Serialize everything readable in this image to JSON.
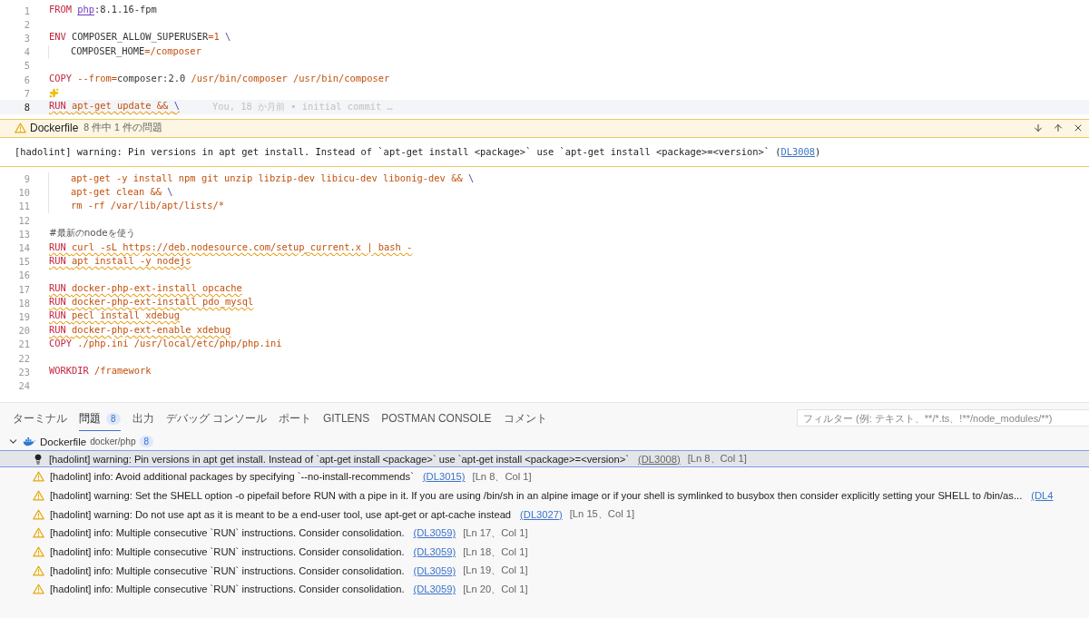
{
  "editor": {
    "lines_before": [
      {
        "number": "1",
        "segments": [
          {
            "text": "FROM ",
            "kind": "keyword"
          },
          {
            "text": "php",
            "kind": "link"
          },
          {
            "text": ":8.1.16-fpm",
            "kind": "plain"
          }
        ]
      },
      {
        "number": "2"
      },
      {
        "number": "3",
        "segments": [
          {
            "text": "ENV ",
            "kind": "keyword"
          },
          {
            "text": "COMPOSER_ALLOW_SUPERUSER",
            "kind": "plain"
          },
          {
            "text": "=1 ",
            "kind": "string"
          },
          {
            "text": "\\",
            "kind": "operator"
          }
        ]
      },
      {
        "number": "4",
        "indent": true,
        "segments": [
          {
            "text": "COMPOSER_HOME",
            "kind": "plain"
          },
          {
            "text": "=/composer",
            "kind": "string"
          }
        ]
      },
      {
        "number": "5"
      },
      {
        "number": "6",
        "segments": [
          {
            "text": "COPY ",
            "kind": "keyword"
          },
          {
            "text": "--from=",
            "kind": "string"
          },
          {
            "text": "composer:2.0 ",
            "kind": "plain"
          },
          {
            "text": "/usr/bin/composer /usr/bin/composer",
            "kind": "string"
          }
        ]
      },
      {
        "number": "7",
        "sparkle": true
      },
      {
        "number": "8",
        "current": true,
        "squiggle": true,
        "blame": "You, 18 か月前 • initial commit …",
        "segments": [
          {
            "text": "RUN ",
            "kind": "keyword"
          },
          {
            "text": "apt-get update && ",
            "kind": "string"
          },
          {
            "text": "\\",
            "kind": "operator"
          }
        ]
      }
    ],
    "peek": {
      "file": "Dockerfile",
      "summary": "8 件中 1 件の問題",
      "message_before": "[hadolint] warning: Pin versions in apt get install. Instead of `apt-get install <package>` use `apt-get install <package>=<version>` (",
      "code": "DL3008",
      "message_after": ")"
    },
    "lines_after": [
      {
        "number": "9",
        "indent": true,
        "segments": [
          {
            "text": "apt-get -y install npm git unzip libzip-dev libicu-dev libonig-dev && ",
            "kind": "string"
          },
          {
            "text": "\\",
            "kind": "operator"
          }
        ]
      },
      {
        "number": "10",
        "indent": true,
        "segments": [
          {
            "text": "apt-get clean && ",
            "kind": "string"
          },
          {
            "text": "\\",
            "kind": "operator"
          }
        ]
      },
      {
        "number": "11",
        "indent": true,
        "segments": [
          {
            "text": "rm -rf /var/lib/apt/lists/*",
            "kind": "string"
          }
        ]
      },
      {
        "number": "12"
      },
      {
        "number": "13",
        "segments": [
          {
            "text": "#最新のnodeを使う",
            "kind": "comment"
          }
        ]
      },
      {
        "number": "14",
        "squiggle": true,
        "segments": [
          {
            "text": "RUN ",
            "kind": "keyword"
          },
          {
            "text": "curl -sL https://deb.nodesource.com/setup_current.x | bash -",
            "kind": "string"
          }
        ]
      },
      {
        "number": "15",
        "squiggle": true,
        "segments": [
          {
            "text": "RUN ",
            "kind": "keyword"
          },
          {
            "text": "apt install -y nodejs",
            "kind": "string"
          }
        ]
      },
      {
        "number": "16"
      },
      {
        "number": "17",
        "squiggle": true,
        "segments": [
          {
            "text": "RUN ",
            "kind": "keyword"
          },
          {
            "text": "docker-php-ext-install opcache",
            "kind": "string"
          }
        ]
      },
      {
        "number": "18",
        "squiggle": true,
        "segments": [
          {
            "text": "RUN ",
            "kind": "keyword"
          },
          {
            "text": "docker-php-ext-install pdo_mysql",
            "kind": "string"
          }
        ]
      },
      {
        "number": "19",
        "squiggle": true,
        "segments": [
          {
            "text": "RUN ",
            "kind": "keyword"
          },
          {
            "text": "pecl install xdebug",
            "kind": "string"
          }
        ]
      },
      {
        "number": "20",
        "squiggle": true,
        "segments": [
          {
            "text": "RUN ",
            "kind": "keyword"
          },
          {
            "text": "docker-php-ext-enable xdebug",
            "kind": "string"
          }
        ]
      },
      {
        "number": "21",
        "segments": [
          {
            "text": "COPY ",
            "kind": "keyword"
          },
          {
            "text": "./php.ini /usr/local/etc/php/php.ini",
            "kind": "string"
          }
        ]
      },
      {
        "number": "22"
      },
      {
        "number": "23",
        "segments": [
          {
            "text": "WORKDIR ",
            "kind": "keyword"
          },
          {
            "text": "/framework",
            "kind": "string"
          }
        ]
      },
      {
        "number": "24"
      }
    ]
  },
  "panel": {
    "tabs": [
      {
        "label": "ターミナル",
        "selected": false
      },
      {
        "label": "問題",
        "selected": true,
        "badge": "8"
      },
      {
        "label": "出力",
        "selected": false
      },
      {
        "label": "デバッグ コンソール",
        "selected": false
      },
      {
        "label": "ポート",
        "selected": false
      },
      {
        "label": "GITLENS",
        "selected": false
      },
      {
        "label": "POSTMAN CONSOLE",
        "selected": false
      },
      {
        "label": "コメント",
        "selected": false
      }
    ],
    "filter": {
      "placeholder": "フィルター (例: テキスト、**/*.ts、!**/node_modules/**)"
    },
    "group": {
      "file": "Dockerfile",
      "path": "docker/php",
      "count": "8",
      "expanded": true,
      "items": [
        {
          "kind": "lightbulb",
          "selected": true,
          "text": "[hadolint] warning: Pin versions in apt get install. Instead of `apt-get install <package>` use `apt-get install <package>=<version>`",
          "code": "(DL3008)",
          "location": "[Ln 8、Col 1]"
        },
        {
          "kind": "warning",
          "selected": false,
          "text": "[hadolint] info: Avoid additional packages by specifying `--no-install-recommends`",
          "code": "(DL3015)",
          "location": "[Ln 8、Col 1]"
        },
        {
          "kind": "warning",
          "selected": false,
          "text": "[hadolint] warning: Set the SHELL option -o pipefail before RUN with a pipe in it. If you are using /bin/sh in an alpine image or if your shell is symlinked to busybox then consider explicitly setting your SHELL to /bin/as...",
          "code": "(DL4"
        },
        {
          "kind": "warning",
          "selected": false,
          "text": "[hadolint] warning: Do not use apt as it is meant to be a end-user tool, use apt-get or apt-cache instead",
          "code": "(DL3027)",
          "location": "[Ln 15、Col 1]"
        },
        {
          "kind": "warning",
          "selected": false,
          "text": "[hadolint] info: Multiple consecutive `RUN` instructions. Consider consolidation.",
          "code": "(DL3059)",
          "location": "[Ln 17、Col 1]"
        },
        {
          "kind": "warning",
          "selected": false,
          "text": "[hadolint] info: Multiple consecutive `RUN` instructions. Consider consolidation.",
          "code": "(DL3059)",
          "location": "[Ln 18、Col 1]"
        },
        {
          "kind": "warning",
          "selected": false,
          "text": "[hadolint] info: Multiple consecutive `RUN` instructions. Consider consolidation.",
          "code": "(DL3059)",
          "location": "[Ln 19、Col 1]"
        },
        {
          "kind": "warning",
          "selected": false,
          "text": "[hadolint] info: Multiple consecutive `RUN` instructions. Consider consolidation.",
          "code": "(DL3059)",
          "location": "[Ln 20、Col 1]"
        }
      ]
    }
  }
}
